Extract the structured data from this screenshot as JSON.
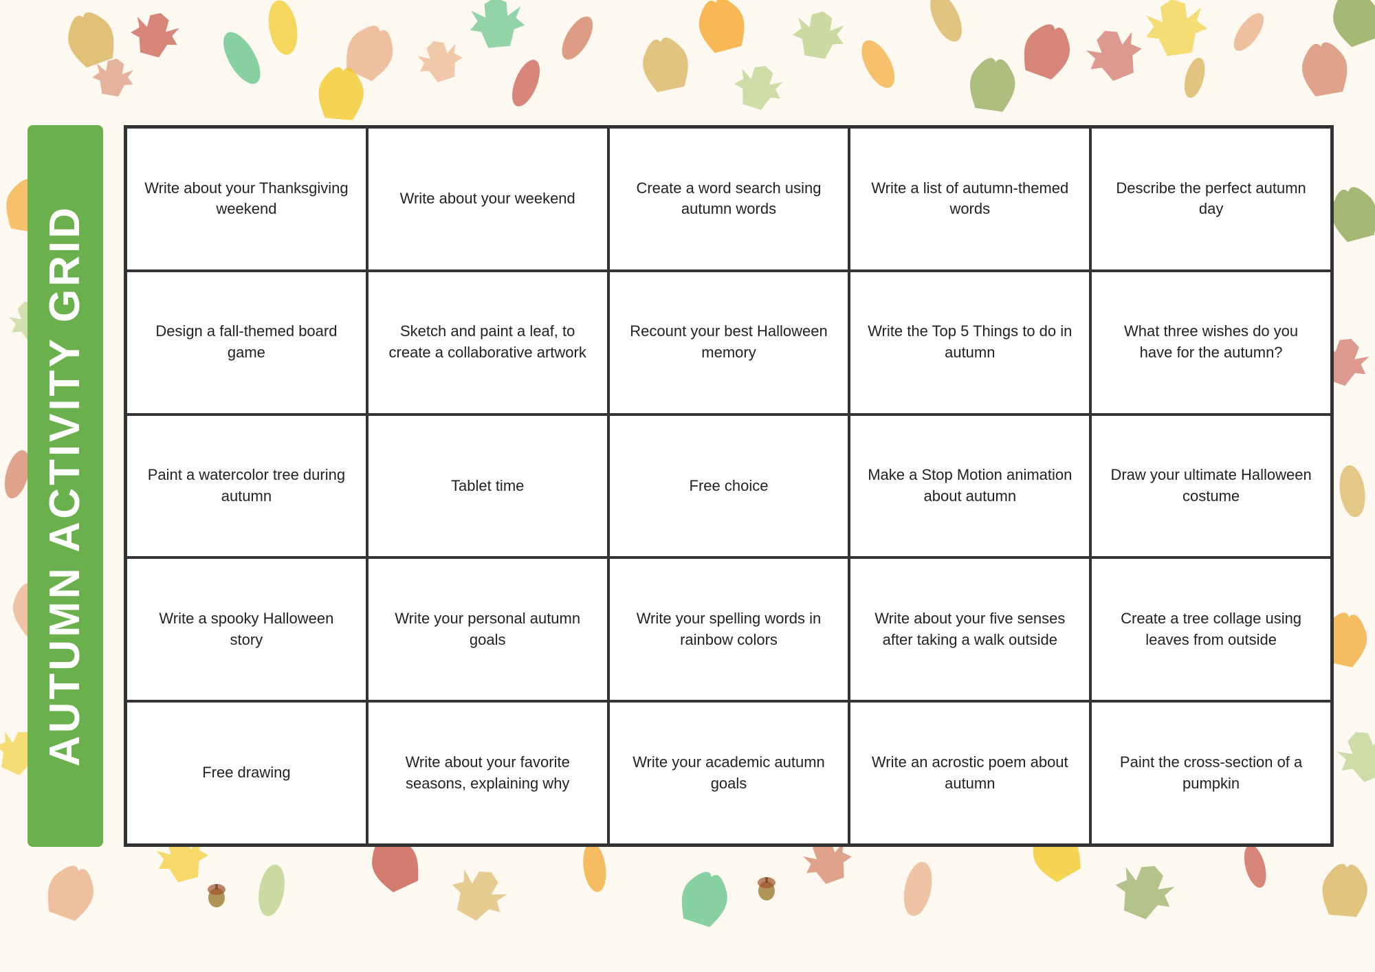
{
  "sidebar": {
    "title": "AUTUMN ACTIVITY GRID"
  },
  "grid": {
    "cells": [
      "Write about your Thanksgiving weekend",
      "Write about your weekend",
      "Create a word search using autumn words",
      "Write a list of autumn-themed words",
      "Describe the perfect autumn day",
      "Design a fall-themed board game",
      "Sketch and paint a leaf, to create a collaborative artwork",
      "Recount your best Halloween memory",
      "Write the Top 5 Things to do in autumn",
      "What three wishes do you have for the autumn?",
      "Paint a watercolor tree during autumn",
      "Tablet time",
      "Free choice",
      "Make a Stop Motion animation about autumn",
      "Draw your ultimate Halloween costume",
      "Write a spooky Halloween story",
      "Write your personal autumn goals",
      "Write your spelling words in rainbow colors",
      "Write about your five senses after taking a walk outside",
      "Create a tree collage using leaves from outside",
      "Free drawing",
      "Write about your favorite seasons, explaining why",
      "Write your academic autumn goals",
      "Write an acrostic poem about autumn",
      "Paint the cross-section of a pumpkin"
    ]
  },
  "leaves": {
    "colors": [
      "#e8a87c",
      "#c0392b",
      "#e74c3c",
      "#f39c12",
      "#f1c40f",
      "#27ae60",
      "#8e44ad",
      "#d4a843",
      "#a8c66c",
      "#cc6b49",
      "#b8860b",
      "#6b8e23"
    ]
  }
}
